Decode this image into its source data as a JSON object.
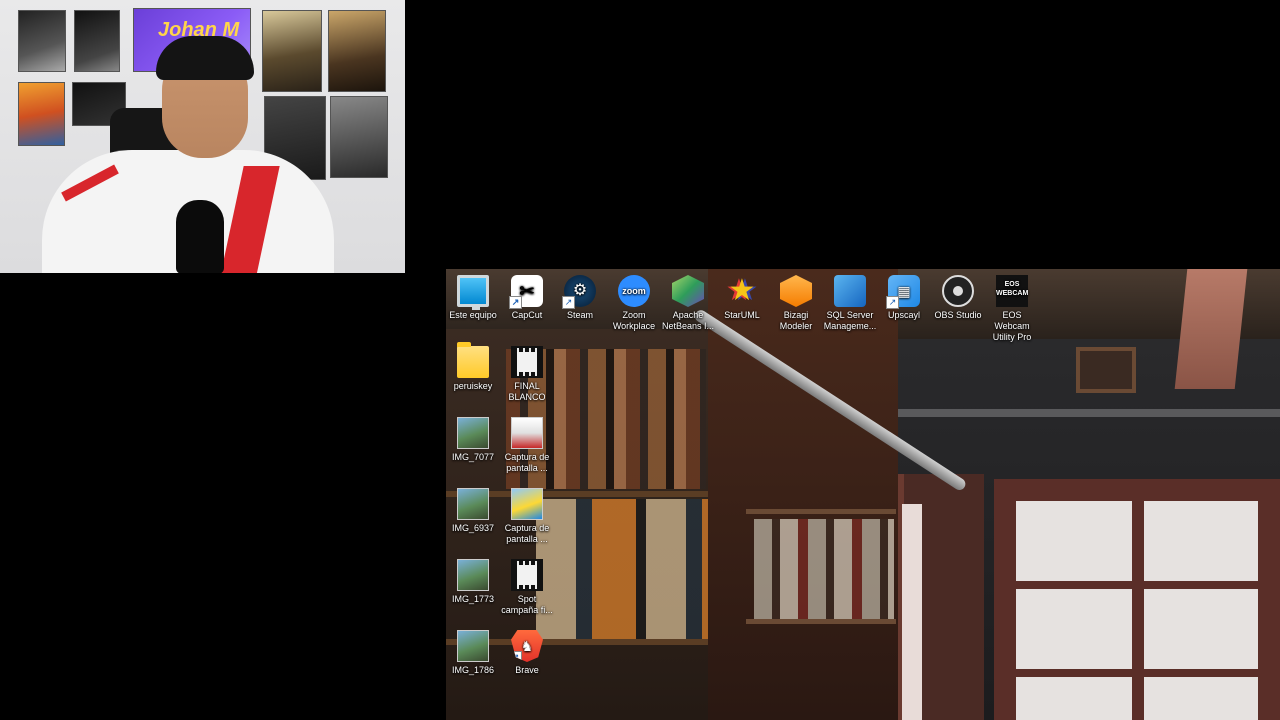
{
  "webcam": {
    "poster_title": "Johan M"
  },
  "desktop": {
    "icons": [
      {
        "label": "Este equipo",
        "icon": "this-pc-icon"
      },
      {
        "label": "CapCut",
        "icon": "capcut-icon"
      },
      {
        "label": "Steam",
        "icon": "steam-icon"
      },
      {
        "label": "Zoom Workplace",
        "icon": "zoom-icon",
        "glyph_text": "zoom"
      },
      {
        "label": "Apache NetBeans I...",
        "icon": "netbeans-icon"
      },
      {
        "label": "StarUML",
        "icon": "staruml-icon"
      },
      {
        "label": "Bizagi Modeler",
        "icon": "bizagi-icon"
      },
      {
        "label": "SQL Server Manageme...",
        "icon": "sql-server-icon"
      },
      {
        "label": "Upscayl",
        "icon": "upscayl-icon"
      },
      {
        "label": "OBS Studio",
        "icon": "obs-icon"
      },
      {
        "label": "EOS Webcam Utility Pro",
        "icon": "eos-webcam-icon",
        "glyph_text": "EOS WEBCAM"
      },
      {
        "label": "peruiskey",
        "icon": "folder-icon"
      },
      {
        "label": "FINAL BLANCO",
        "icon": "video-file-icon"
      },
      {
        "label": "IMG_7077",
        "icon": "image-file-icon"
      },
      {
        "label": "Captura de pantalla ...",
        "icon": "screenshot-file-icon"
      },
      {
        "label": "IMG_6937",
        "icon": "image-file-icon"
      },
      {
        "label": "Captura de pantalla ...",
        "icon": "screenshot-file-icon"
      },
      {
        "label": "IMG_1773",
        "icon": "image-file-icon"
      },
      {
        "label": "Spot campaña fi...",
        "icon": "video-file-icon"
      },
      {
        "label": "IMG_1786",
        "icon": "image-file-icon"
      },
      {
        "label": "Brave",
        "icon": "brave-icon"
      }
    ]
  }
}
